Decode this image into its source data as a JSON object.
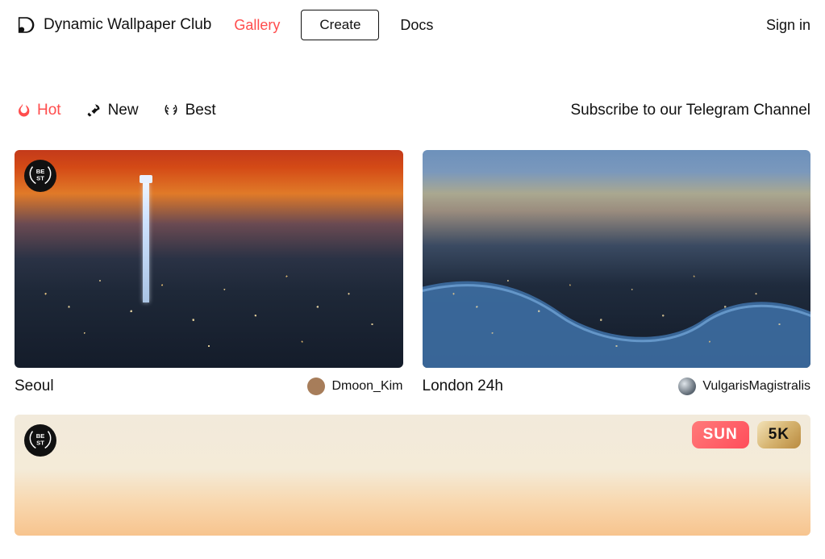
{
  "brand": "Dynamic Wallpaper Club",
  "nav": {
    "gallery": "Gallery",
    "create": "Create",
    "docs": "Docs",
    "signin": "Sign in"
  },
  "tabs": {
    "hot": "Hot",
    "new": "New",
    "best": "Best"
  },
  "telegram_cta": "Subscribe to our Telegram Channel",
  "cards": [
    {
      "title": "Seoul",
      "author": "Dmoon_Kim",
      "best_badge": true
    },
    {
      "title": "London 24h",
      "author": "VulgarisMagistralis",
      "best_badge": false
    }
  ],
  "wide_card": {
    "best_badge": true,
    "tags": {
      "sun": "SUN",
      "five_k": "5K"
    }
  },
  "colors": {
    "accent": "#ff4d4d"
  }
}
